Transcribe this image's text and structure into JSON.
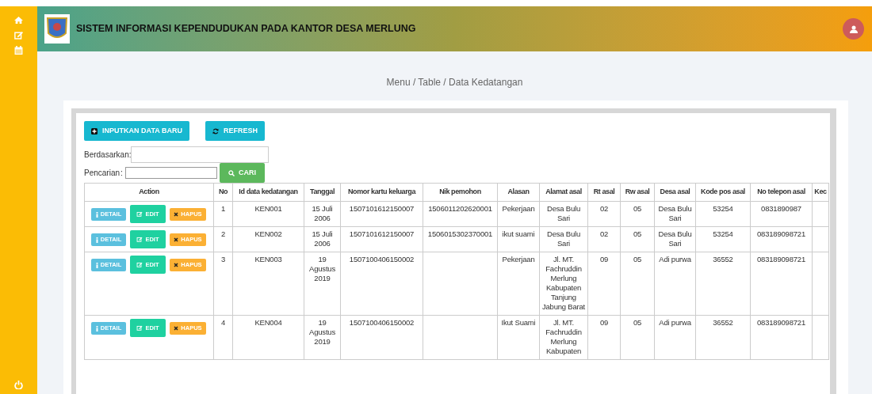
{
  "header": {
    "title": "SISTEM INFORMASI KEPENDUDUKAN PADA KANTOR DESA MERLUNG"
  },
  "breadcrumb": "Menu / Table / Data Kedatangan",
  "toolbar": {
    "buttons": [
      {
        "kind": "add",
        "label": "INPUTKAN DATA BARU"
      },
      {
        "kind": "refresh",
        "label": "REFRESH"
      }
    ]
  },
  "filter": {
    "by_label": "Berdasarkan:",
    "search_label": "Pencarian",
    "search_separator": ":",
    "search_button": "CARI"
  },
  "table": {
    "columns": [
      "Action",
      "No",
      "Id data kedatangan",
      "Tanggal",
      "Nomor kartu keluarga",
      "Nik pemohon",
      "Alasan",
      "Alamat asal",
      "Rt asal",
      "Rw asal",
      "Desa asal",
      "Kode pos asal",
      "No telepon asal",
      "Kec"
    ],
    "rows": [
      {
        "cells": [
          {
            "actions": [
              {
                "kind": "detail",
                "label": "DETAIL"
              },
              {
                "kind": "edit",
                "label": "EDIT"
              },
              {
                "kind": "delete",
                "label": "HAPUS"
              }
            ]
          },
          "1",
          "KEN001",
          "15 Juli 2006",
          "1507101612150007",
          "1506011202620001",
          "Pekerjaan",
          "Desa Bulu Sari",
          "02",
          "05",
          "Desa Bulu Sari",
          "53254",
          "0831890987"
        ]
      },
      {
        "cells": [
          {
            "actions": [
              {
                "kind": "detail",
                "label": "DETAIL"
              },
              {
                "kind": "edit",
                "label": "EDIT"
              },
              {
                "kind": "delete",
                "label": "HAPUS"
              }
            ]
          },
          "2",
          "KEN002",
          "15 Juli 2006",
          "1507101612150007",
          "1506015302370001",
          "ikut suami",
          "Desa Bulu Sari",
          "02",
          "05",
          "Desa Bulu Sari",
          "53254",
          "083189098721"
        ]
      },
      {
        "cells": [
          {
            "actions": [
              {
                "kind": "detail",
                "label": "DETAIL"
              },
              {
                "kind": "edit",
                "label": "EDIT"
              },
              {
                "kind": "delete",
                "label": "HAPUS"
              }
            ]
          },
          "3",
          "KEN003",
          "19 Agustus 2019",
          "1507100406150002",
          "",
          "Pekerjaan",
          "Jl. MT. Fachruddin Merlung Kabupaten Tanjung Jabung Barat",
          "09",
          "05",
          "Adi purwa",
          "36552",
          "083189098721"
        ]
      },
      {
        "cells": [
          {
            "actions": [
              {
                "kind": "detail",
                "label": "DETAIL"
              },
              {
                "kind": "edit",
                "label": "EDIT"
              },
              {
                "kind": "delete",
                "label": "HAPUS"
              }
            ]
          },
          "4",
          "KEN004",
          "19 Agustus 2019",
          "1507100406150002",
          "",
          "Ikut Suami",
          "Jl. MT. Fachruddin Merlung Kabupaten",
          "09",
          "05",
          "Adi purwa",
          "36552",
          "083189098721"
        ]
      }
    ]
  }
}
